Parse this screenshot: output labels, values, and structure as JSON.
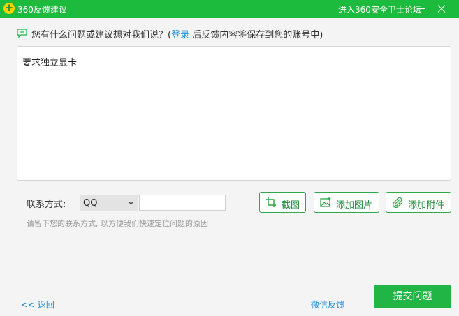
{
  "window": {
    "title": "360反馈建议",
    "forum_link": "进入360安全卫士论坛",
    "logo_icon": "360-logo-icon",
    "minimize_icon": "minimize-icon",
    "close_icon": "close-icon",
    "accent_color": "#1dbb3d"
  },
  "prompt": {
    "icon": "chat-bubble-icon",
    "question": "您有什么问题或建议想对我们说？(",
    "login_link": "登录",
    "suffix": " 后反馈内容将保存到您的账号中)"
  },
  "feedback": {
    "value": "要求独立显卡"
  },
  "contact": {
    "label": "联系方式:",
    "method_selected": "QQ",
    "input_value": "",
    "hint": "请留下您的联系方式, 以方便我们快速定位问题的原因"
  },
  "actions": {
    "screenshot": {
      "label": "截图",
      "icon": "crop-icon"
    },
    "add_image": {
      "label": "添加图片",
      "icon": "image-icon"
    },
    "add_attachment": {
      "label": "添加附件",
      "icon": "paperclip-icon"
    }
  },
  "footer": {
    "back": "<< 返回",
    "wechat": "微信反馈",
    "submit": "提交问题"
  }
}
